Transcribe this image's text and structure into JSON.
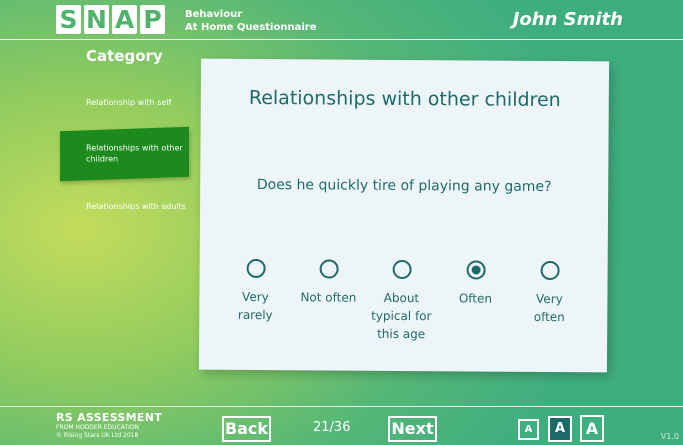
{
  "header": {
    "logo_letters": [
      "S",
      "N",
      "A",
      "P"
    ],
    "subtitle_line1": "Behaviour",
    "subtitle_line2": "At Home Questionnaire",
    "user_name": "John Smith"
  },
  "sidebar": {
    "title": "Category",
    "items": [
      {
        "label": "Relationship with self",
        "active": false
      },
      {
        "label": "Relationships with other children",
        "active": true
      },
      {
        "label": "Relationships with adults",
        "active": false
      }
    ]
  },
  "card": {
    "section_title": "Relationships with other children",
    "question": "Does he quickly tire of playing any game?",
    "options": [
      {
        "label": "Very rarely",
        "selected": false
      },
      {
        "label": "Not often",
        "selected": false
      },
      {
        "label": "About typical for this age",
        "selected": false
      },
      {
        "label": "Often",
        "selected": true
      },
      {
        "label": "Very often",
        "selected": false
      }
    ]
  },
  "footer": {
    "brand_main": "RS ASSESSMENT",
    "brand_sub1": "FROM HODDER EDUCATION",
    "brand_sub2": "© Rising Stars UK Ltd 2018",
    "back_label": "Back",
    "page_counter": "21/36",
    "next_label": "Next",
    "text_sizes": [
      "A",
      "A",
      "A"
    ],
    "version": "V1.0"
  },
  "colors": {
    "accent": "#1e6a6a",
    "active_category": "#1d8a1d",
    "card_background": "#eef5f8"
  }
}
